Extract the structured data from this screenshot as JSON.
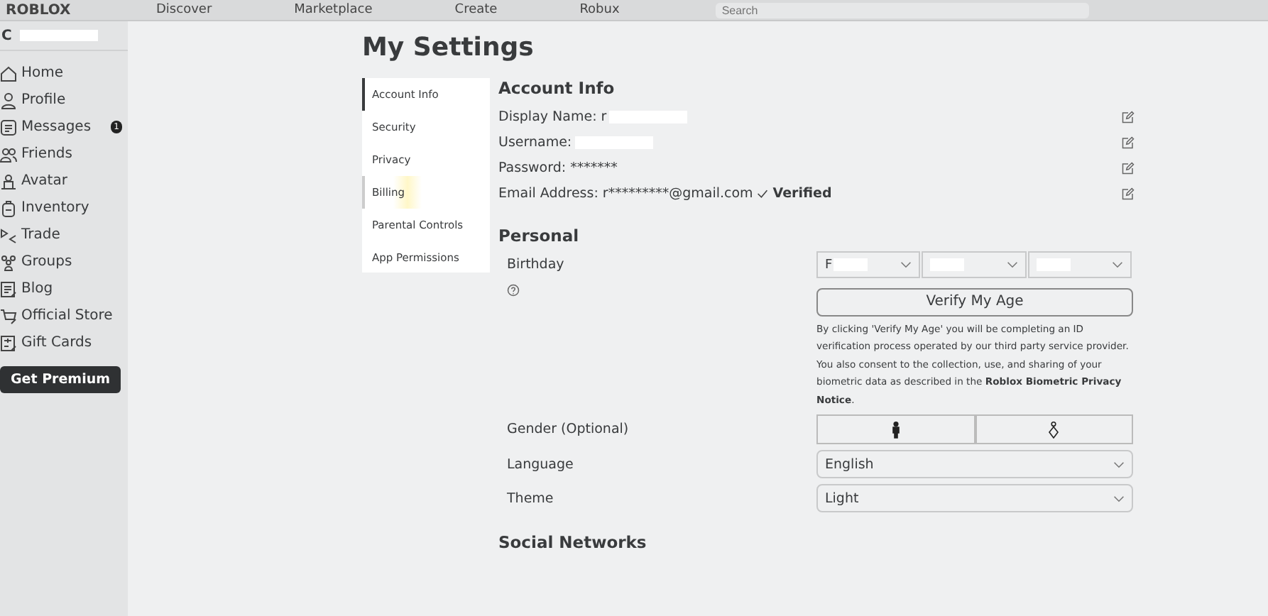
{
  "topbar": {
    "logo": "ROBLOX",
    "links": [
      "Discover",
      "Marketplace",
      "Create",
      "Robux"
    ],
    "search": {
      "placeholder": "Search"
    }
  },
  "sidebar": {
    "user": "C",
    "items": [
      {
        "label": "Home",
        "kind": "home"
      },
      {
        "label": "Profile",
        "kind": "profile"
      },
      {
        "label": "Messages",
        "kind": "messages",
        "badge": "1"
      },
      {
        "label": "Friends",
        "kind": "friends"
      },
      {
        "label": "Avatar",
        "kind": "avatar"
      },
      {
        "label": "Inventory",
        "kind": "inventory"
      },
      {
        "label": "Trade",
        "kind": "trade"
      },
      {
        "label": "Groups",
        "kind": "groups"
      },
      {
        "label": "Blog",
        "kind": "blog"
      },
      {
        "label": "Official Store",
        "kind": "store"
      },
      {
        "label": "Gift Cards",
        "kind": "gift"
      }
    ],
    "premium_button": "Get Premium"
  },
  "page_title": "My Settings",
  "settings_nav": [
    {
      "label": "Account Info",
      "selected": true
    },
    {
      "label": "Security",
      "selected": false
    },
    {
      "label": "Privacy",
      "selected": false
    },
    {
      "label": "Billing",
      "selected": false,
      "hovered": true
    },
    {
      "label": "Parental Controls",
      "selected": false
    },
    {
      "label": "App Permissions",
      "selected": false
    }
  ],
  "account_info": {
    "title": "Account Info",
    "rows": [
      {
        "label": "Display Name:",
        "value": "r",
        "redacted": true
      },
      {
        "label": "Username:",
        "redacted": true
      },
      {
        "label": "Password:",
        "value": "*******"
      },
      {
        "label": "Email Address:",
        "value": "r*********@gmail.com",
        "verified": "Verified"
      }
    ]
  },
  "personal": {
    "title": "Personal",
    "birthday": {
      "label": "Birthday",
      "selects": [
        {
          "value": "F",
          "redacted": true
        },
        {
          "redacted": true
        },
        {
          "redacted": true
        }
      ]
    },
    "verify_button": "Verify My Age",
    "verify_note": "By clicking 'Verify My Age' you will be completing an ID verification process operated by our third party service provider. You also consent to the collection, use, and sharing of your biometric data as described in the **Roblox Biometric Privacy Notice**.",
    "gender": {
      "label": "Gender (Optional)",
      "options": [
        {
          "kind": "male",
          "selected": true
        },
        {
          "kind": "female",
          "selected": false
        }
      ]
    },
    "language": {
      "label": "Language",
      "value": "English"
    },
    "theme": {
      "label": "Theme",
      "value": "Light"
    }
  },
  "social": {
    "title": "Social Networks"
  }
}
